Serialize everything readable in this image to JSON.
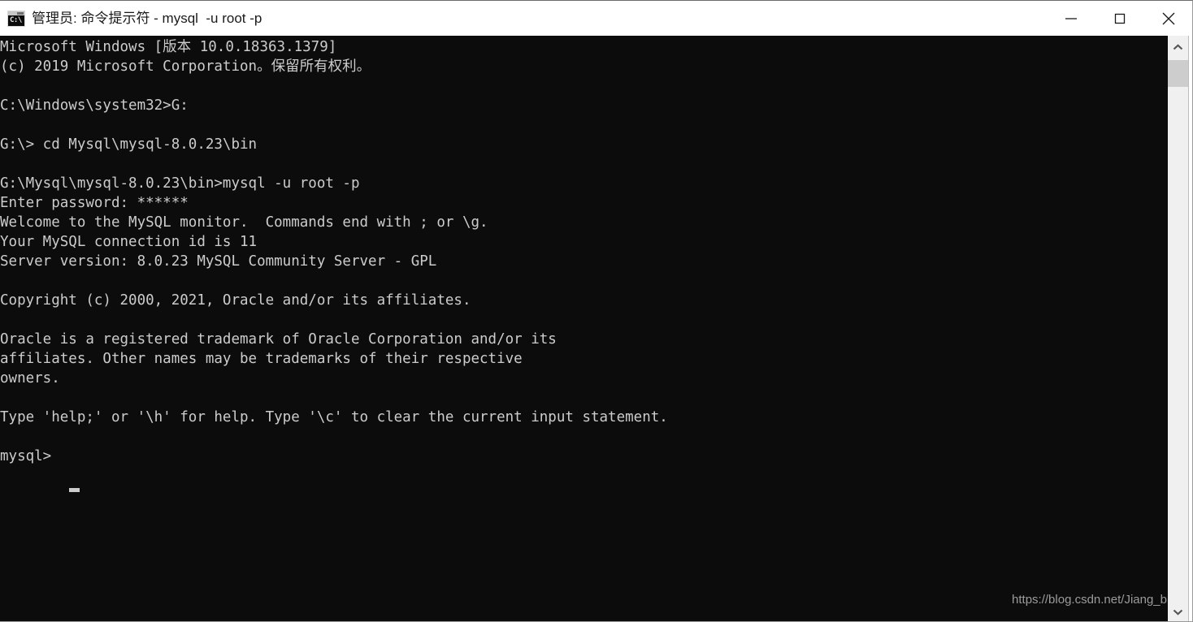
{
  "window": {
    "title": "管理员: 命令提示符 - mysql  -u root -p",
    "icon": "cmd-icon",
    "icon_glyph": "C:\\",
    "controls": {
      "minimize": "minimize-button",
      "maximize": "maximize-button",
      "close": "close-button"
    }
  },
  "console": {
    "background_color": "#0c0c0c",
    "text_color": "#cccccc",
    "lines": "Microsoft Windows [版本 10.0.18363.1379]\n(c) 2019 Microsoft Corporation。保留所有权利。\n\nC:\\Windows\\system32>G:\n\nG:\\> cd Mysql\\mysql-8.0.23\\bin\n\nG:\\Mysql\\mysql-8.0.23\\bin>mysql -u root -p\nEnter password: ******\nWelcome to the MySQL monitor.  Commands end with ; or \\g.\nYour MySQL connection id is 11\nServer version: 8.0.23 MySQL Community Server - GPL\n\nCopyright (c) 2000, 2021, Oracle and/or its affiliates.\n\nOracle is a registered trademark of Oracle Corporation and/or its\naffiliates. Other names may be trademarks of their respective\nowners.\n\nType 'help;' or '\\h' for help. Type '\\c' to clear the current input statement.\n\nmysql> ",
    "prompt": "mysql>",
    "cursor": "block-cursor"
  },
  "watermark": {
    "text": "https://blog.csdn.net/Jiang_b"
  },
  "scrollbar": {
    "up_arrow": "scroll-up-arrow",
    "down_arrow": "scroll-down-arrow",
    "thumb": "scroll-thumb"
  }
}
